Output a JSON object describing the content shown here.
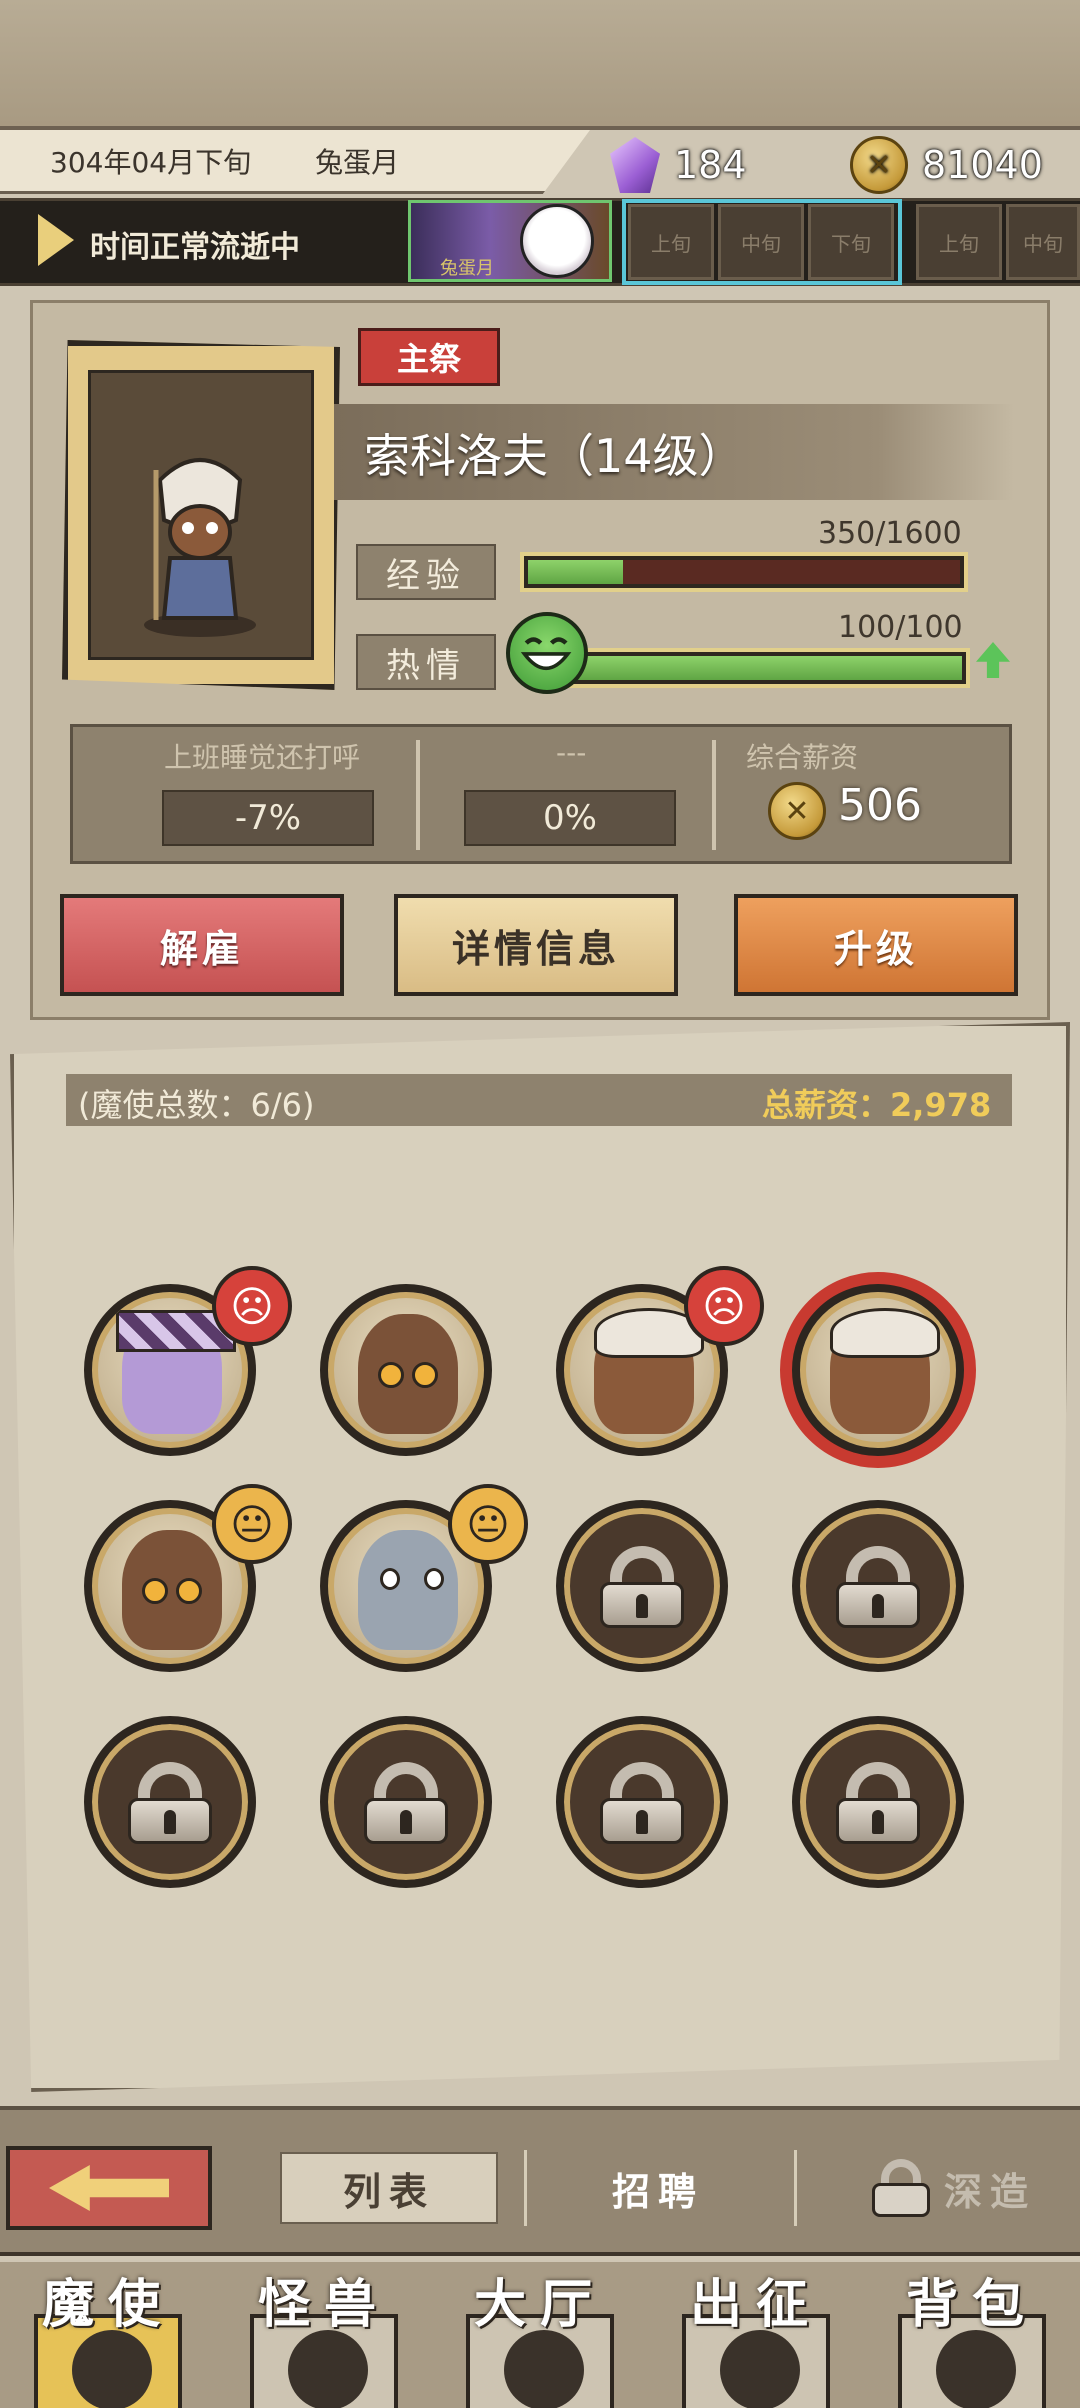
{
  "header": {
    "date": "304年04月下旬",
    "month_name": "兔蛋月",
    "crystal_count": "184",
    "coin_count": "81040"
  },
  "time_bar": {
    "status": "时间正常流逝中",
    "month_card_label": "兔蛋月",
    "slots": [
      "上旬",
      "中旬",
      "下旬",
      "上旬",
      "中旬"
    ]
  },
  "character": {
    "role": "主祭",
    "name": "索科洛夫（14级）",
    "exp_label": "经验",
    "exp_value": "350/1600",
    "exp_fraction": 0.22,
    "passion_label": "热情",
    "passion_value": "100/100",
    "passion_fraction": 1.0,
    "trait_1_title": "上班睡觉还打呼",
    "trait_1_value": "-7%",
    "trait_2_title": "---",
    "trait_2_value": "0%",
    "salary_title": "综合薪资",
    "salary_value": "506"
  },
  "actions": {
    "dismiss": "解雇",
    "details": "详情信息",
    "upgrade": "升级"
  },
  "roster": {
    "count_label": "(魔使总数：6/6)",
    "total_salary_label": "总薪资：2,978",
    "members": [
      {
        "name": "member-1",
        "mood": "angry",
        "locked": false
      },
      {
        "name": "member-2",
        "mood": "",
        "locked": false
      },
      {
        "name": "member-3",
        "mood": "angry",
        "locked": false
      },
      {
        "name": "member-4",
        "mood": "",
        "locked": false,
        "selected": true
      },
      {
        "name": "member-5",
        "mood": "neutral",
        "locked": false
      },
      {
        "name": "member-6",
        "mood": "neutral",
        "locked": false
      }
    ],
    "locked_slots": 6
  },
  "subnav": {
    "list": "列表",
    "recruit": "招聘",
    "deep": "深造"
  },
  "mainnav": {
    "items": [
      "魔使",
      "怪兽",
      "大厅",
      "出征",
      "背包"
    ],
    "active": "魔使"
  },
  "colors": {
    "accent_red": "#c9403a",
    "gold": "#f0cc5a",
    "bar_green": "#5fa544"
  }
}
